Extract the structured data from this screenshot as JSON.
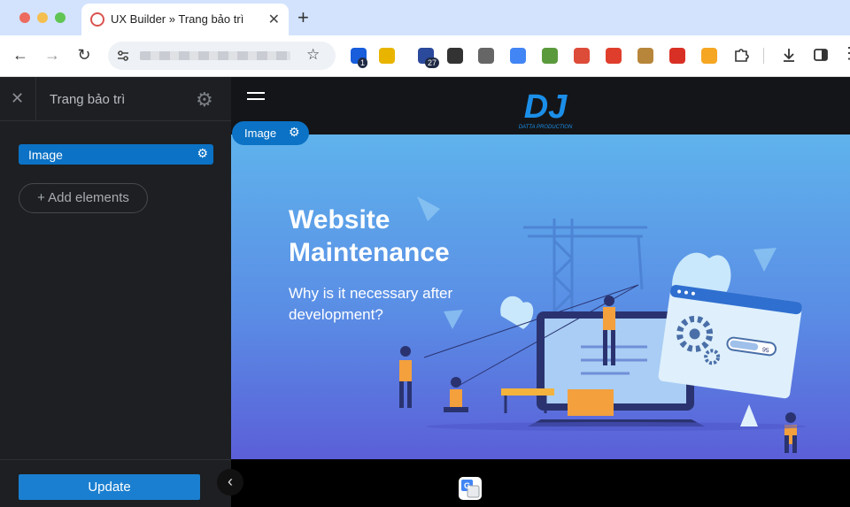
{
  "browser": {
    "tab_title": "UX Builder » Trang bảo trì",
    "tab_close": "✕",
    "new_tab": "+",
    "extensions": [
      {
        "name": "bitwarden-icon",
        "badge": "1",
        "color": "#175ddc"
      },
      {
        "name": "lock-icon",
        "badge": "",
        "color": "#e9b400"
      },
      {
        "name": "graduation-icon",
        "badge": "27",
        "color": "#2b4a9c"
      },
      {
        "name": "qr-icon",
        "badge": "",
        "color": "#333333"
      },
      {
        "name": "gear-extension-icon",
        "badge": "",
        "color": "#666666"
      },
      {
        "name": "google-translate-icon",
        "badge": "",
        "color": "#4285f4"
      },
      {
        "name": "puzzle-green-icon",
        "badge": "",
        "color": "#5b9a3c"
      },
      {
        "name": "angular-icon",
        "badge": "",
        "color": "#dd4b39"
      },
      {
        "name": "zotero-icon",
        "badge": "",
        "color": "#e03e2d"
      },
      {
        "name": "cookie-icon",
        "badge": "",
        "color": "#b8863b"
      },
      {
        "name": "bug-icon",
        "badge": "",
        "color": "#d93025"
      },
      {
        "name": "play-icon",
        "badge": "",
        "color": "#f5a623"
      }
    ]
  },
  "panel": {
    "close": "✕",
    "title": "Trang bảo trì",
    "element_label": "Image",
    "add_elements": "+ Add elements",
    "update": "Update",
    "collapse": "‹"
  },
  "canvas": {
    "image_tag": "Image",
    "hero_title": "Website Maintenance",
    "hero_subtitle": "Why is it necessary after development?",
    "logo_text": "DJ",
    "logo_subtext": "DATTA PRODUCTION",
    "progress_label": "95"
  }
}
